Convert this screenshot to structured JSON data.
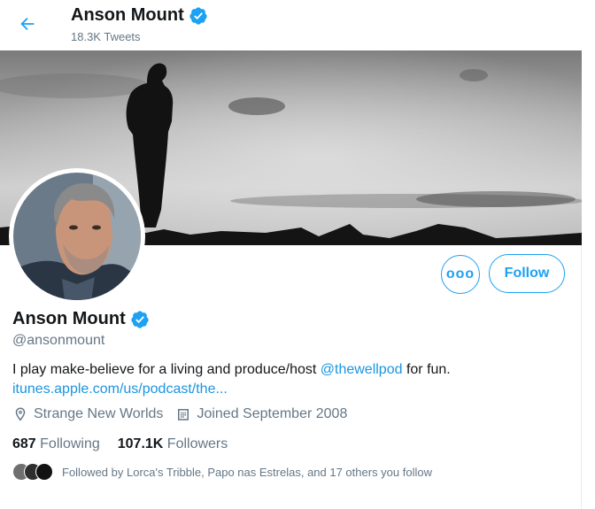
{
  "header": {
    "name": "Anson Mount",
    "tweet_count": "18.3K Tweets"
  },
  "profile": {
    "name": "Anson Mount",
    "handle": "@ansonmount",
    "bio_before": "I play make-believe for a living and produce/host ",
    "bio_mention": "@thewellpod",
    "bio_after": " for fun.",
    "url": "itunes.apple.com/us/podcast/the...",
    "location": "Strange New Worlds",
    "joined": "Joined September 2008",
    "following_count": "687",
    "following_label": "Following",
    "followers_count": "107.1K",
    "followers_label": "Followers",
    "followed_by": "Followed by Lorca's Tribble, Papo nas Estrelas, and 17 others you follow"
  },
  "buttons": {
    "follow": "Follow",
    "more": "ooo"
  },
  "colors": {
    "accent": "#1da1f2",
    "link": "#1b95e0",
    "secondary_text": "#657786"
  },
  "icons": [
    "back-arrow-icon",
    "verified-badge-icon",
    "location-pin-icon",
    "calendar-icon",
    "more-options-icon"
  ]
}
